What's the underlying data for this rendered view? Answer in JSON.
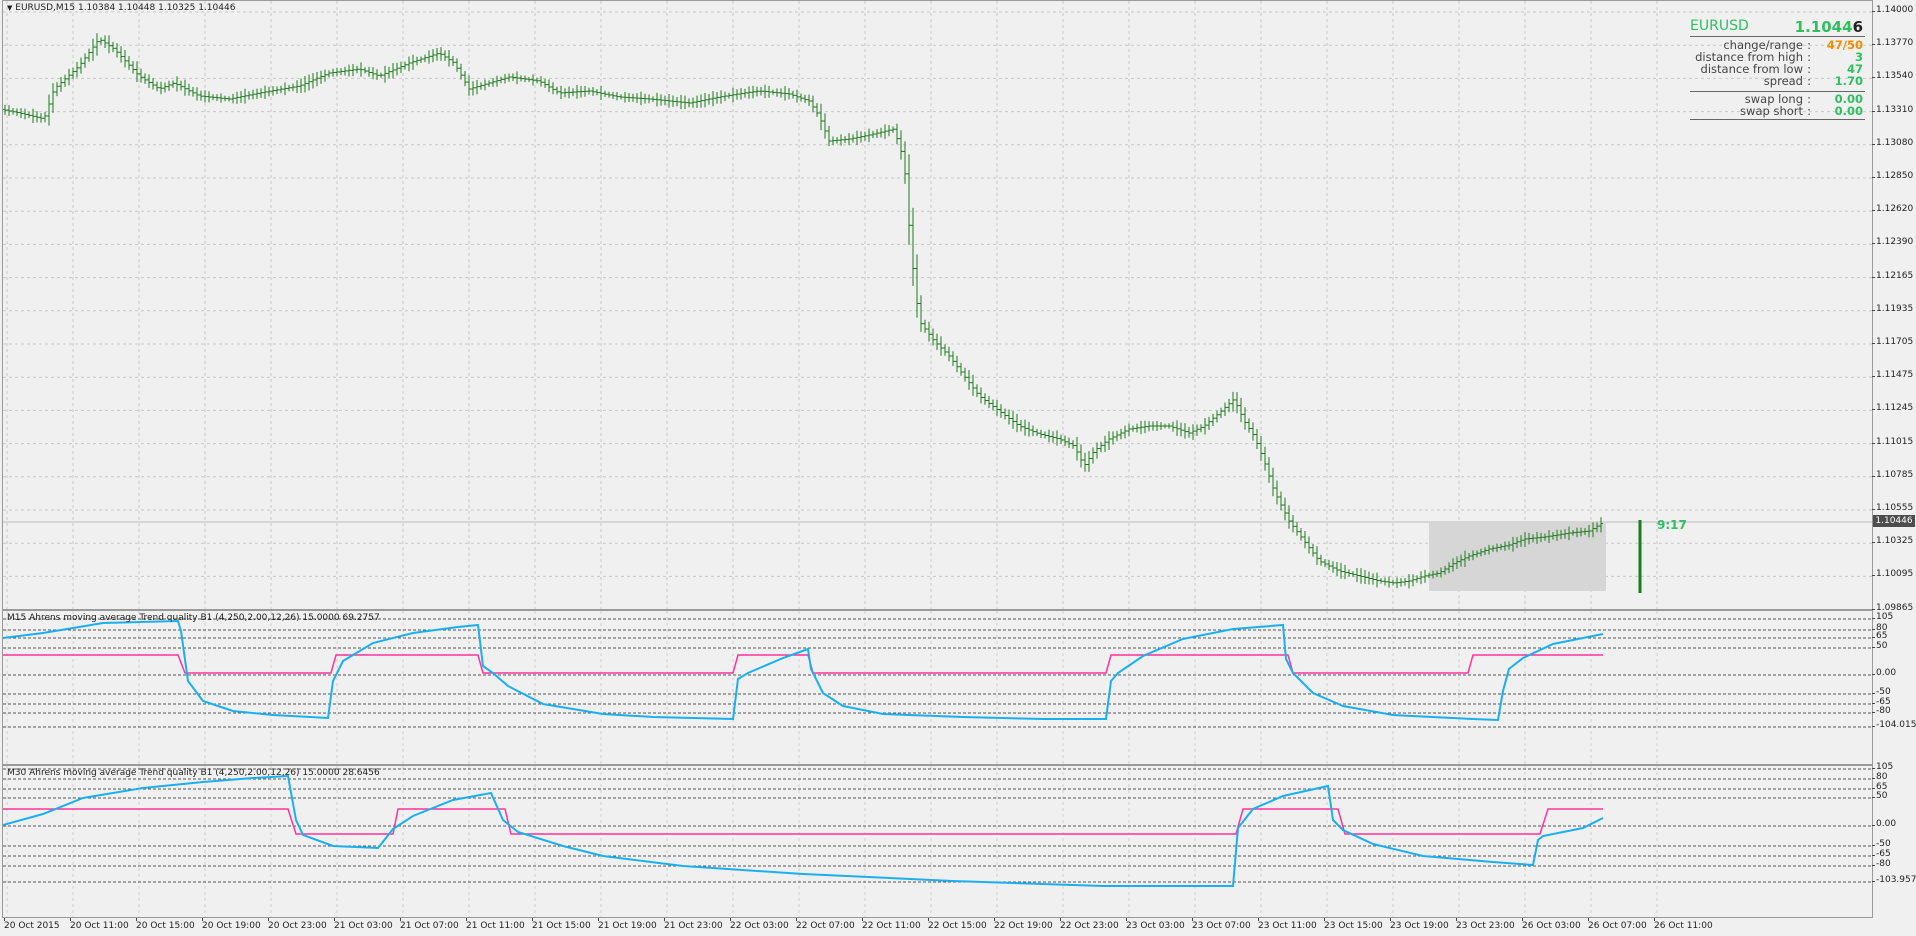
{
  "main_pane": {
    "title": "EURUSD,M15  1.10384 1.10448 1.10325 1.10446",
    "price_labels": [
      "1.14000",
      "1.13770",
      "1.13540",
      "1.13310",
      "1.13080",
      "1.12850",
      "1.12620",
      "1.12390",
      "1.12165",
      "1.11935",
      "1.11705",
      "1.11475",
      "1.11245",
      "1.11015",
      "1.10785",
      "1.10555",
      "1.10325",
      "1.10095",
      "1.09865"
    ],
    "current_price": "1.10446",
    "timer": "9:17",
    "candle_color": "#1e7a1e",
    "info": {
      "symbol": "EURUSD",
      "price": "1.1044",
      "price_last_digit": "6",
      "rows": [
        {
          "label": "change/range",
          "value": "47/50",
          "color": "#f28c00"
        },
        {
          "label": "distance from high",
          "value": "3",
          "color": "#2fbf5f"
        },
        {
          "label": "distance from low",
          "value": "47",
          "color": "#2fbf5f"
        },
        {
          "label": "spread",
          "value": "1.70",
          "color": "#2fbf5f"
        }
      ],
      "swap_rows": [
        {
          "label": "swap long",
          "value": "0.00",
          "color": "#2fbf5f"
        },
        {
          "label": "swap short",
          "value": "0.00",
          "color": "#2fbf5f"
        }
      ]
    }
  },
  "indicator_1": {
    "title": "M15 Ahrens moving average Trend quality B1 (4,250,2.00,12,26) 15.0000 69.2757",
    "levels": [
      "105",
      "80",
      "65",
      "50",
      "0.00",
      "-50",
      "-65",
      "-80",
      "-104.0153"
    ],
    "line_color": "#1ab0ef",
    "signal_color": "#ff3399"
  },
  "indicator_2": {
    "title": "M30 Ahrens moving average Trend quality B1 (4,250,2.00,12,26) 15.0000 28.6456",
    "levels": [
      "105",
      "80",
      "65",
      "50",
      "0.00",
      "-50",
      "-65",
      "-80",
      "-103.9574"
    ],
    "line_color": "#1ab0ef",
    "signal_color": "#ff3399"
  },
  "time_axis": [
    "20 Oct 2015",
    "20 Oct 11:00",
    "20 Oct 15:00",
    "20 Oct 19:00",
    "20 Oct 23:00",
    "21 Oct 03:00",
    "21 Oct 07:00",
    "21 Oct 11:00",
    "21 Oct 15:00",
    "21 Oct 19:00",
    "21 Oct 23:00",
    "22 Oct 03:00",
    "22 Oct 07:00",
    "22 Oct 11:00",
    "22 Oct 15:00",
    "22 Oct 19:00",
    "22 Oct 23:00",
    "23 Oct 03:00",
    "23 Oct 07:00",
    "23 Oct 11:00",
    "23 Oct 15:00",
    "23 Oct 19:00",
    "23 Oct 23:00",
    "26 Oct 03:00",
    "26 Oct 07:00",
    "26 Oct 11:00"
  ]
}
